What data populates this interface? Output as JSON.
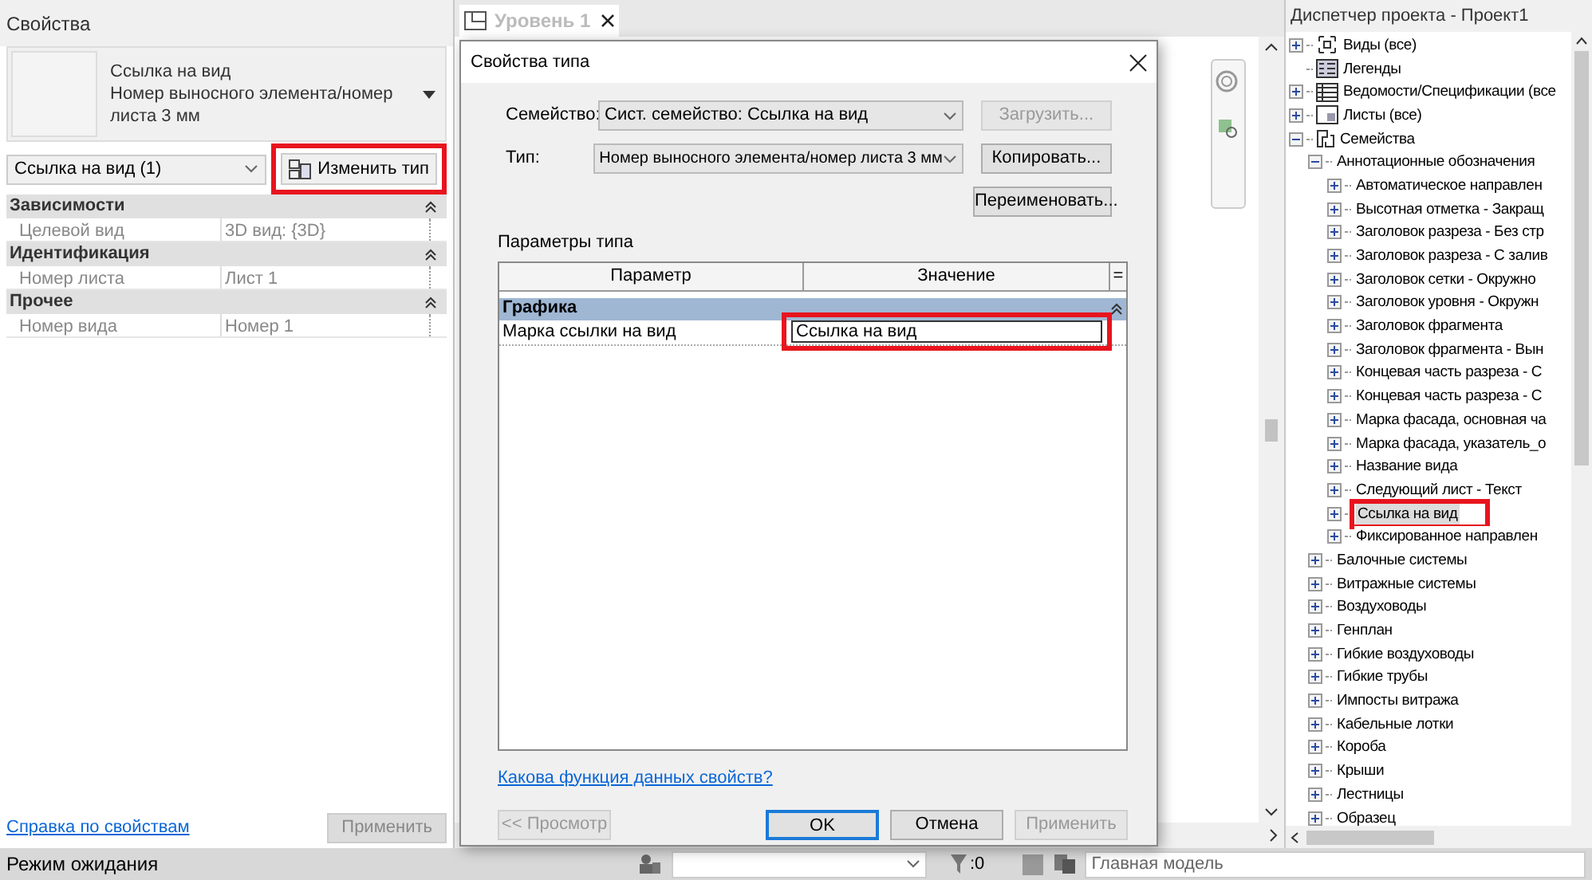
{
  "properties": {
    "title": "Свойства",
    "type_name": "Ссылка на вид",
    "type_detail": "Номер выносного элемента/номер листа 3 мм",
    "selector": "Ссылка на вид (1)",
    "edit_type_button": {
      "label": "Изменить тип",
      "highlighted": true
    },
    "groups": [
      {
        "title": "Зависимости",
        "expanded": true,
        "rows": [
          {
            "name": "Целевой вид",
            "value": "3D вид: {3D}"
          }
        ]
      },
      {
        "title": "Идентификация",
        "expanded": true,
        "rows": [
          {
            "name": "Номер листа",
            "value": "Лист 1"
          }
        ]
      },
      {
        "title": "Прочее",
        "expanded": true,
        "rows": [
          {
            "name": "Номер вида",
            "value": "Номер 1"
          }
        ]
      }
    ],
    "help_link": "Справка по свойствам",
    "apply_button": {
      "label": "Применить",
      "disabled": true
    }
  },
  "view_tab": {
    "label": "Уровень 1",
    "selected": true
  },
  "dialog": {
    "title": "Свойства типа",
    "family_label": "Семейство:",
    "family_value": "Сист. семейство: Ссылка на вид",
    "type_label": "Тип:",
    "type_value": "Номер выносного элемента/номер листа 3 мм",
    "side_buttons": [
      {
        "label": "Загрузить...",
        "disabled": true
      },
      {
        "label": "Копировать...",
        "disabled": false
      },
      {
        "label": "Переименовать...",
        "disabled": false
      }
    ],
    "params_label": "Параметры типа",
    "columns": [
      "Параметр",
      "Значение",
      "="
    ],
    "groups": [
      {
        "title": "Графика",
        "expanded": true,
        "rows": [
          {
            "name": "Марка ссылки на вид",
            "value": "Ссылка на вид",
            "highlighted": true
          }
        ]
      }
    ],
    "help_link": "Какова функция данных свойств?",
    "buttons": [
      {
        "label": "<< Просмотр",
        "disabled": true,
        "default": false
      },
      {
        "label": "OK",
        "disabled": false,
        "default": true
      },
      {
        "label": "Отмена",
        "disabled": false,
        "default": false
      },
      {
        "label": "Применить",
        "disabled": true,
        "default": false
      }
    ]
  },
  "browser": {
    "title": "Диспетчер проекта - Проект1",
    "tree": [
      {
        "label": "Виды (все)",
        "kind": "views",
        "expanded": false,
        "selected": false
      },
      {
        "label": "Легенды",
        "kind": "legends",
        "selected": false
      },
      {
        "label": "Ведомости/Спецификации (все",
        "kind": "schedules",
        "expanded": false,
        "selected": false
      },
      {
        "label": "Листы (все)",
        "kind": "sheets",
        "expanded": false,
        "selected": false
      },
      {
        "label": "Семейства",
        "kind": "families",
        "expanded": true,
        "selected": false,
        "children": [
          {
            "label": "Аннотационные обозначения",
            "expanded": true,
            "selected": false,
            "children": [
              {
                "label": "Автоматическое направлен",
                "expanded": false,
                "selected": false
              },
              {
                "label": "Высотная отметка - Закращ",
                "expanded": false,
                "selected": false
              },
              {
                "label": "Заголовок разреза - Без стр",
                "expanded": false,
                "selected": false
              },
              {
                "label": "Заголовок разреза - С залив",
                "expanded": false,
                "selected": false
              },
              {
                "label": "Заголовок сетки - Окружно",
                "expanded": false,
                "selected": false
              },
              {
                "label": "Заголовок уровня - Окружн",
                "expanded": false,
                "selected": false
              },
              {
                "label": "Заголовок фрагмента",
                "expanded": false,
                "selected": false
              },
              {
                "label": "Заголовок фрагмента - Вын",
                "expanded": false,
                "selected": false
              },
              {
                "label": "Концевая часть разреза - С",
                "expanded": false,
                "selected": false
              },
              {
                "label": "Концевая часть разреза - С",
                "expanded": false,
                "selected": false
              },
              {
                "label": "Марка фасада, основная ча",
                "expanded": false,
                "selected": false
              },
              {
                "label": "Марка фасада, указатель_о",
                "expanded": false,
                "selected": false
              },
              {
                "label": "Название вида",
                "expanded": false,
                "selected": false
              },
              {
                "label": "Следующий лист - Текст",
                "expanded": false,
                "selected": false
              },
              {
                "label": "Ссылка на вид",
                "expanded": false,
                "selected": true,
                "highlighted": true
              },
              {
                "label": "Фиксированное направлен",
                "expanded": false,
                "selected": false
              }
            ]
          },
          {
            "label": "Балочные системы",
            "expanded": false,
            "selected": false
          },
          {
            "label": "Витражные системы",
            "expanded": false,
            "selected": false
          },
          {
            "label": "Воздуховоды",
            "expanded": false,
            "selected": false
          },
          {
            "label": "Генплан",
            "expanded": false,
            "selected": false
          },
          {
            "label": "Гибкие воздуховоды",
            "expanded": false,
            "selected": false
          },
          {
            "label": "Гибкие трубы",
            "expanded": false,
            "selected": false
          },
          {
            "label": "Импосты витража",
            "expanded": false,
            "selected": false
          },
          {
            "label": "Кабельные лотки",
            "expanded": false,
            "selected": false
          },
          {
            "label": "Короба",
            "expanded": false,
            "selected": false
          },
          {
            "label": "Крыши",
            "expanded": false,
            "selected": false
          },
          {
            "label": "Лестницы",
            "expanded": false,
            "selected": false
          },
          {
            "label": "Образец",
            "expanded": false,
            "selected": false
          }
        ]
      }
    ]
  },
  "status_bar": {
    "message": "Режим ожидания",
    "filter_count": ":0",
    "model": "Главная модель"
  }
}
